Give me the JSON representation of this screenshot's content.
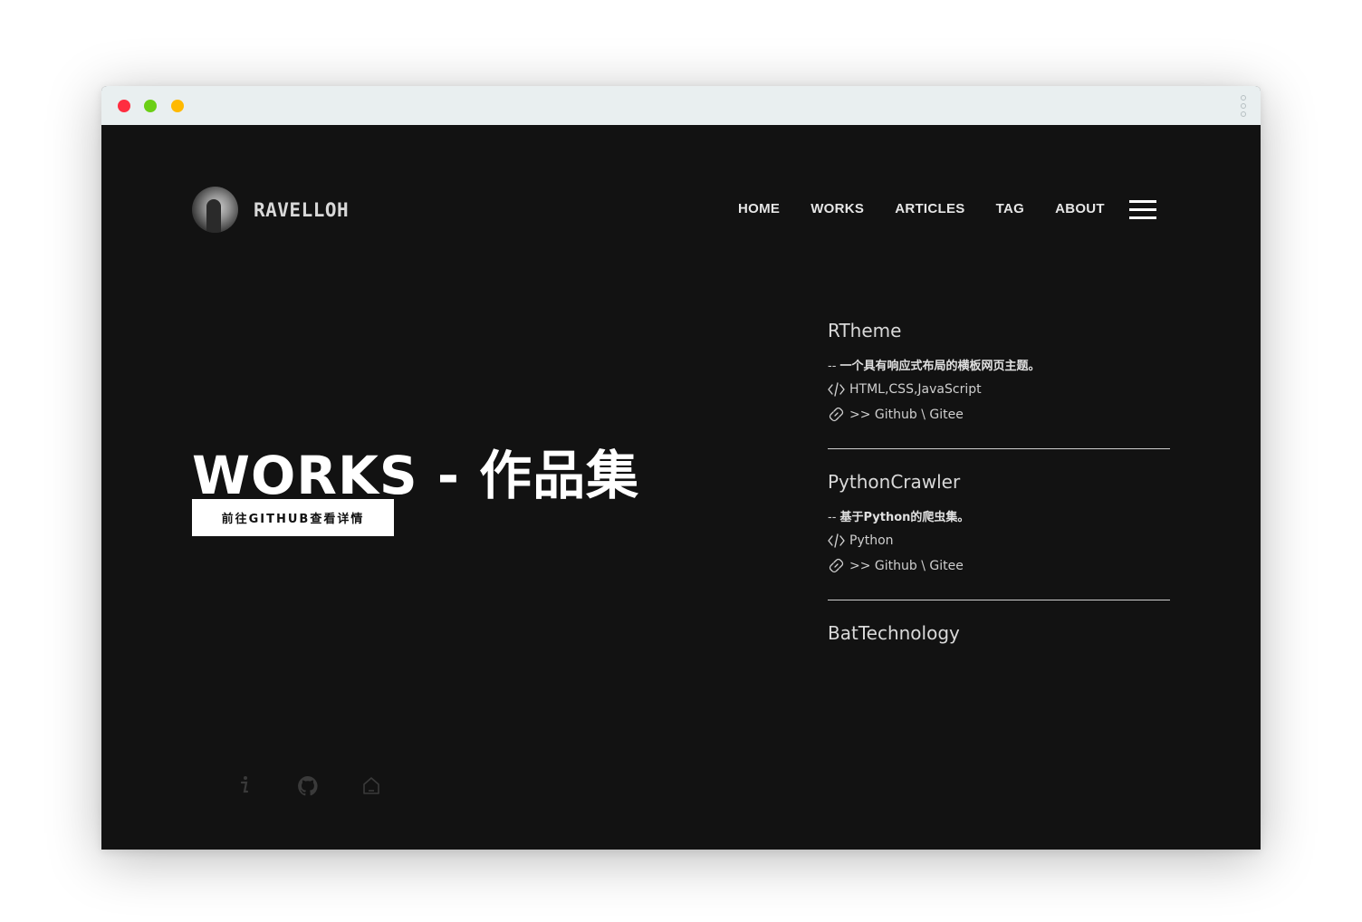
{
  "brand": {
    "name": "RAVELLOH"
  },
  "nav": {
    "items": [
      "HOME",
      "WORKS",
      "ARTICLES",
      "TAG",
      "ABOUT"
    ],
    "menu_icon": "hamburger-icon"
  },
  "hero": {
    "title": "WORKS - 作品集",
    "button_label": "前往GITHUB查看详情"
  },
  "works": [
    {
      "title": "RTheme",
      "desc_prefix": "-- ",
      "desc": "一个具有响应式布局的横板网页主题。",
      "tech": "HTML,CSS,JavaScript",
      "links": ">> Github \\ Gitee"
    },
    {
      "title": "PythonCrawler",
      "desc_prefix": "-- ",
      "desc": "基于Python的爬虫集。",
      "tech": "Python",
      "links": ">> Github \\ Gitee"
    },
    {
      "title": "BatTechnology",
      "desc_prefix": "",
      "desc": "",
      "tech": "",
      "links": ""
    }
  ],
  "social": {
    "icons": [
      "info-icon",
      "github-icon",
      "home-icon"
    ]
  },
  "colors": {
    "background": "#121212",
    "titlebar": "#e9eff0",
    "traffic_red": "#ff2d40",
    "traffic_green": "#6bcf15",
    "traffic_yellow": "#ffb900"
  }
}
